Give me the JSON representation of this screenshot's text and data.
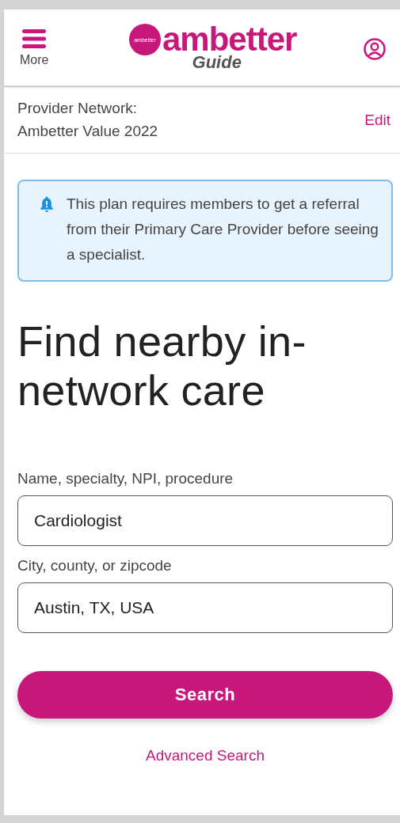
{
  "header": {
    "menu_label": "More",
    "logo": {
      "badge": "ambetter",
      "wordmark": "ambetter",
      "subtitle": "Guide"
    }
  },
  "network": {
    "label": "Provider Network:",
    "value": "Ambetter Value 2022",
    "action": "Edit"
  },
  "alert": {
    "text": "This plan requires members to get a referral from their Primary Care Provider before seeing a specialist."
  },
  "heading": "Find nearby in-network care",
  "fields": [
    {
      "label": "Name, specialty, NPI, procedure",
      "value": "Cardiologist"
    },
    {
      "label": "City, county, or zipcode",
      "value": "Austin, TX, USA"
    }
  ],
  "search_button": "Search",
  "advanced_link": "Advanced Search"
}
